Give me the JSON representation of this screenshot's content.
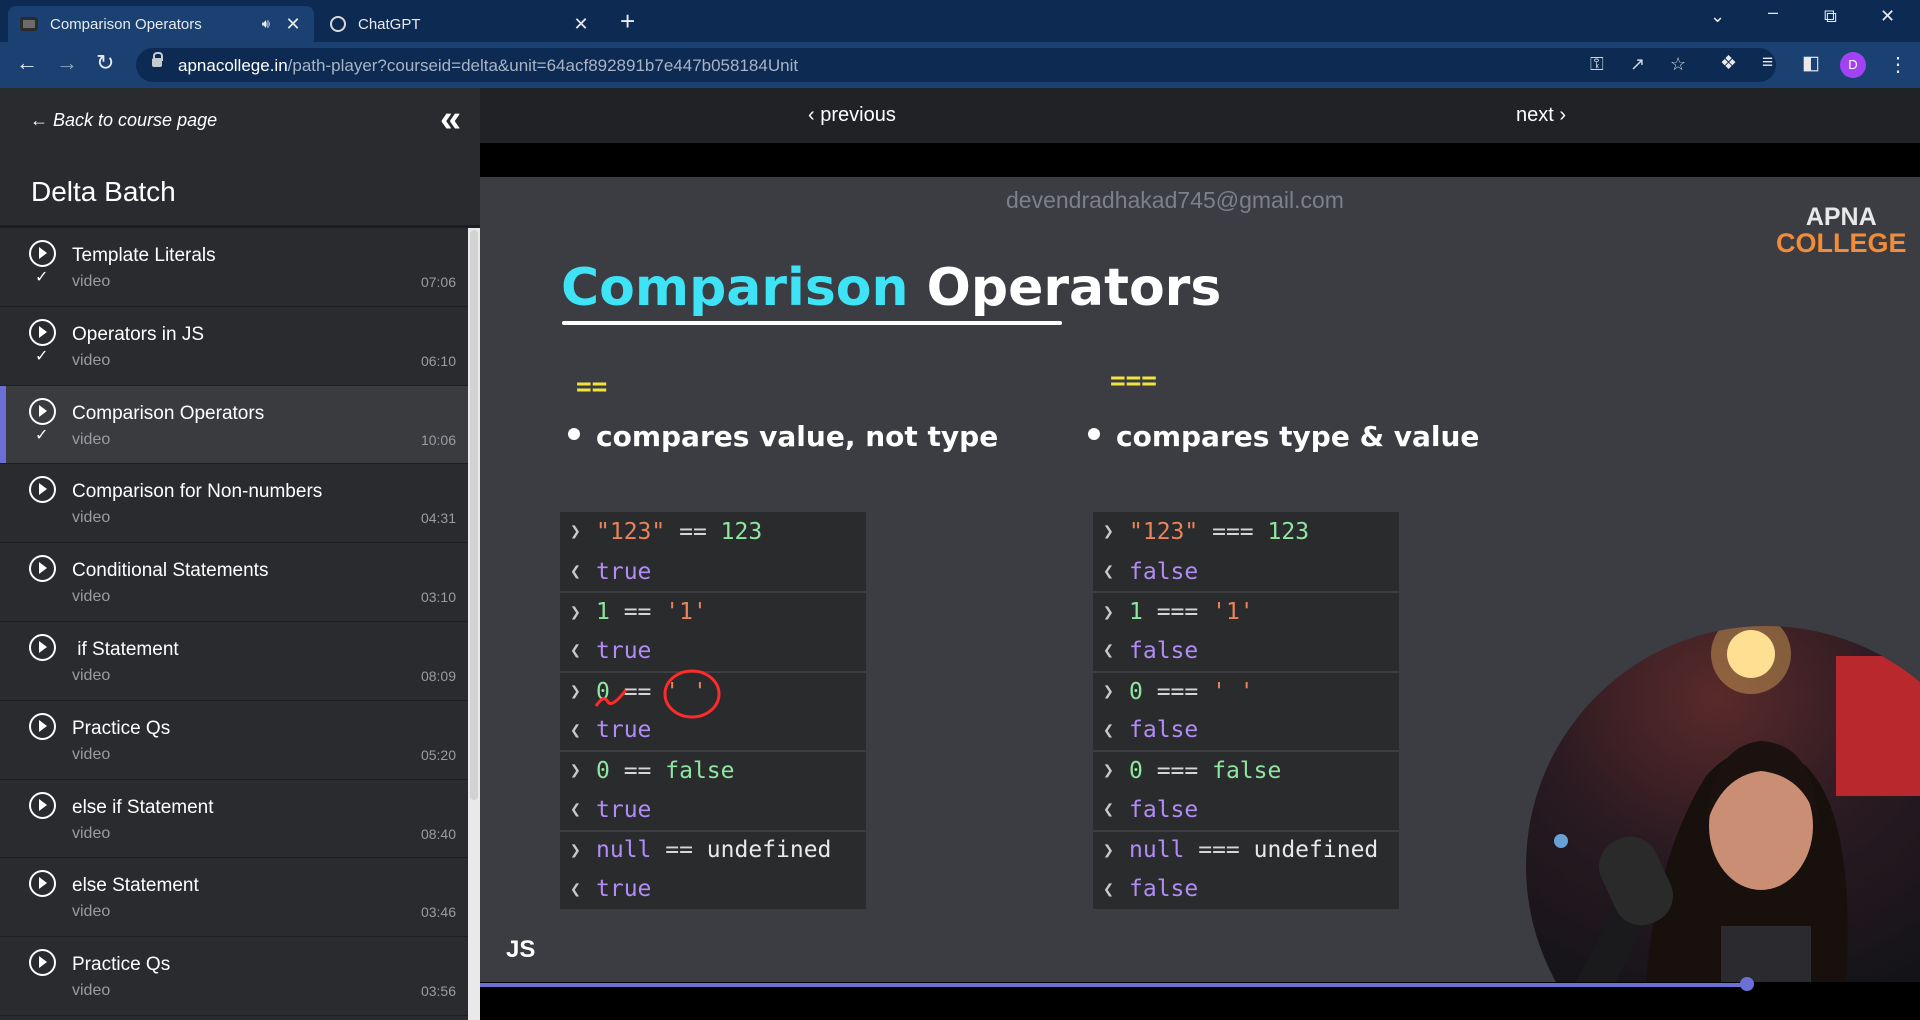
{
  "browser": {
    "tabs": [
      {
        "title": "Comparison Operators",
        "active": true,
        "icon": "apnacollege-favicon",
        "audio": true
      },
      {
        "title": "ChatGPT",
        "active": false,
        "icon": "chatgpt-favicon"
      }
    ],
    "url_host": "apnacollege.in",
    "url_path": "/path-player?courseid=delta&unit=64acf892891b7e447b058184Unit",
    "profile_initial": "D"
  },
  "sidebar": {
    "back_label": "Back to course page",
    "course_title": "Delta Batch",
    "lessons": [
      {
        "title": "Template Literals",
        "type": "video",
        "duration": "07:06",
        "done": true
      },
      {
        "title": "Operators in JS",
        "type": "video",
        "duration": "06:10",
        "done": true
      },
      {
        "title": "Comparison Operators",
        "type": "video",
        "duration": "10:06",
        "done": true,
        "current": true
      },
      {
        "title": "Comparison for Non-numbers",
        "type": "video",
        "duration": "04:31",
        "done": false
      },
      {
        "title": "Conditional Statements",
        "type": "video",
        "duration": "03:10",
        "done": false
      },
      {
        "title": " if Statement",
        "type": "video",
        "duration": "08:09",
        "done": false
      },
      {
        "title": "Practice Qs",
        "type": "video",
        "duration": "05:20",
        "done": false
      },
      {
        "title": "else if Statement",
        "type": "video",
        "duration": "08:40",
        "done": false
      },
      {
        "title": "else Statement",
        "type": "video",
        "duration": "03:46",
        "done": false
      },
      {
        "title": "Practice Qs",
        "type": "video",
        "duration": "03:56",
        "done": false
      }
    ]
  },
  "player": {
    "prev_label": "previous",
    "next_label": "next",
    "progress_fraction": 0.88,
    "slide": {
      "watermark": "devendradhakad745@gmail.com",
      "logo_line1": "APNA",
      "logo_line2": "COLLEGE",
      "title_part1": "Comparison",
      "title_part2": "Operators",
      "left_op": "==",
      "left_bullet": "compares value, not type",
      "right_op": "===",
      "right_bullet": "compares type & value",
      "footer": "JS",
      "left_console": [
        {
          "expr": [
            [
              "c-str",
              "\"123\""
            ],
            [
              "c-op",
              " == "
            ],
            [
              "c-num",
              "123"
            ]
          ],
          "result": "true"
        },
        {
          "expr": [
            [
              "c-num",
              "1"
            ],
            [
              "c-op",
              " == "
            ],
            [
              "c-str",
              "'1'"
            ]
          ],
          "result": "true"
        },
        {
          "expr": [
            [
              "c-num",
              "0"
            ],
            [
              "c-op",
              " == "
            ],
            [
              "c-str",
              "' '"
            ]
          ],
          "result": "true"
        },
        {
          "expr": [
            [
              "c-num",
              "0"
            ],
            [
              "c-op",
              " == "
            ],
            [
              "c-num",
              "false"
            ]
          ],
          "result": "true"
        },
        {
          "expr": [
            [
              "c-kw",
              "null"
            ],
            [
              "c-op",
              " == "
            ],
            [
              "c-plain",
              "undefined"
            ]
          ],
          "result": "true"
        }
      ],
      "right_console": [
        {
          "expr": [
            [
              "c-str",
              "\"123\""
            ],
            [
              "c-op",
              " === "
            ],
            [
              "c-num",
              "123"
            ]
          ],
          "result": "false"
        },
        {
          "expr": [
            [
              "c-num",
              "1"
            ],
            [
              "c-op",
              " === "
            ],
            [
              "c-str",
              "'1'"
            ]
          ],
          "result": "false"
        },
        {
          "expr": [
            [
              "c-num",
              "0"
            ],
            [
              "c-op",
              " === "
            ],
            [
              "c-str",
              "' '"
            ]
          ],
          "result": "false"
        },
        {
          "expr": [
            [
              "c-num",
              "0"
            ],
            [
              "c-op",
              " === "
            ],
            [
              "c-num",
              "false"
            ]
          ],
          "result": "false"
        },
        {
          "expr": [
            [
              "c-kw",
              "null"
            ],
            [
              "c-op",
              " === "
            ],
            [
              "c-plain",
              "undefined"
            ]
          ],
          "result": "false"
        }
      ]
    }
  },
  "colors": {
    "accent": "#6b6fd6",
    "title_cyan": "#3ee3f5",
    "op_yellow": "#f2e33d"
  }
}
